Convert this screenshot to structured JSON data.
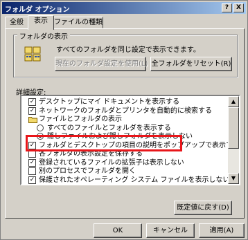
{
  "window": {
    "title": "フォルダ オプション",
    "help_btn": "?",
    "close_btn": "X"
  },
  "tabs": [
    {
      "label": "全般"
    },
    {
      "label": "表示"
    },
    {
      "label": "ファイルの種類"
    }
  ],
  "folder_view": {
    "legend": "フォルダの表示",
    "text": "すべてのフォルダを同じ設定で表示できます。",
    "apply_btn": "現在のフォルダ設定を使用(L)",
    "reset_btn": "全フォルダをリセット(R)"
  },
  "detail": {
    "label": "詳細設定:",
    "items": [
      {
        "kind": "checkbox",
        "checked": true,
        "indent": 0,
        "label": "デスクトップにマイ ドキュメントを表示する"
      },
      {
        "kind": "checkbox",
        "checked": true,
        "indent": 0,
        "label": "ネットワークのフォルダとプリンタを自動的に検索する"
      },
      {
        "kind": "folder",
        "checked": false,
        "indent": 0,
        "label": "ファイルとフォルダの表示"
      },
      {
        "kind": "radio",
        "checked": false,
        "indent": 1,
        "label": "すべてのファイルとフォルダを表示する"
      },
      {
        "kind": "radio",
        "checked": true,
        "indent": 1,
        "label": "隠しファイルおよび隠しフォルダを表示しない"
      },
      {
        "kind": "checkbox",
        "checked": true,
        "indent": 0,
        "label": "フォルダとデスクトップの項目の説明をポップアップで表示する"
      },
      {
        "kind": "checkbox",
        "checked": false,
        "indent": 0,
        "label": "各フォルダの表示設定を保存する"
      },
      {
        "kind": "checkbox",
        "checked": true,
        "indent": 0,
        "label": "登録されているファイルの拡張子は表示しない"
      },
      {
        "kind": "checkbox",
        "checked": false,
        "indent": 0,
        "label": "別のプロセスでフォルダを開く"
      },
      {
        "kind": "checkbox",
        "checked": true,
        "indent": 0,
        "label": "保護されたオペレーティング システム ファイルを表示しない (推奨)"
      }
    ]
  },
  "highlight_color": "#e8161a",
  "restore_btn": "既定値に戻す(D)",
  "footer": {
    "ok": "OK",
    "cancel": "キャンセル",
    "apply": "適用(A)"
  }
}
